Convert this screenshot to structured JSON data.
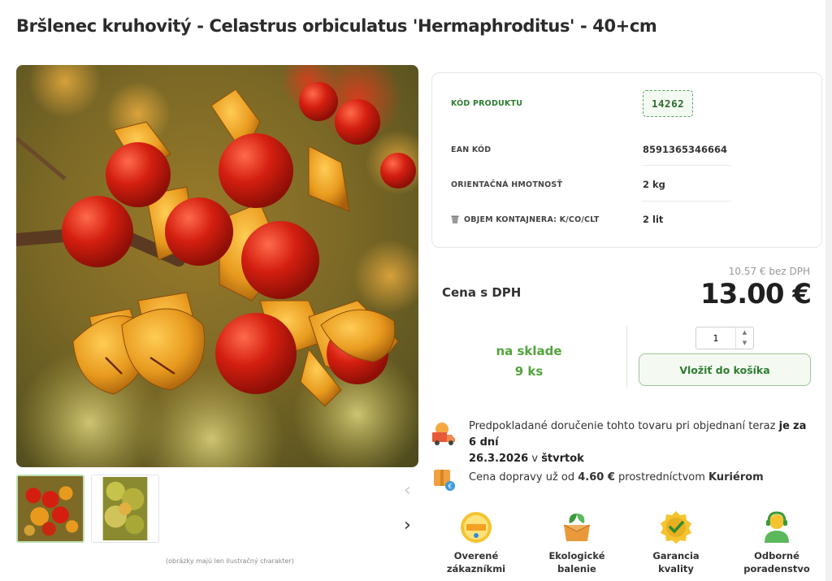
{
  "product": {
    "title": "Bršlenec kruhovitý - Celastrus orbiculatus 'Hermaphroditus' - 40+cm",
    "image_note": "(obrázky majú len ilustračný charakter)"
  },
  "info": {
    "code_label": "KÓD PRODUKTU",
    "code_value": "14262",
    "ean_label": "EAN KÓD",
    "ean_value": "8591365346664",
    "weight_label": "ORIENTAČNÁ HMOTNOSŤ",
    "weight_value": "2 kg",
    "container_label": "OBJEM KONTAJNERA: K/CO/CLT",
    "container_value": "2 lit"
  },
  "price": {
    "without_vat": "10.57 € bez DPH",
    "label": "Cena s DPH",
    "value": "13.00 €"
  },
  "stock": {
    "line1": "na sklade",
    "line2": "9 ks"
  },
  "cart": {
    "quantity": "1",
    "button_label": "Vložiť do košíka"
  },
  "delivery": {
    "text": "Predpokladané doručenie tohto tovaru pri objednaní teraz",
    "je": "je",
    "days": "za 6 dní",
    "date": "26.3.2026",
    "v": "v",
    "weekday": "štvrtok"
  },
  "shipping": {
    "prefix": "Cena dopravy už od",
    "price": "4.60 €",
    "middle": "prostredníctvom",
    "carrier": "Kuriérom"
  },
  "badges": [
    {
      "line1": "Overené",
      "line2": "zákazníkmi",
      "icon": "verified-seal-icon"
    },
    {
      "line1": "Ekologické",
      "line2": "balenie",
      "icon": "eco-box-icon"
    },
    {
      "line1": "Garancia",
      "line2": "kvality",
      "icon": "quality-check-icon"
    },
    {
      "line1": "Odborné",
      "line2": "poradenstvo",
      "icon": "advisor-icon"
    }
  ],
  "colors": {
    "accent_green": "#52a43c",
    "button_border": "#9fc596",
    "code_border": "#5aa65f"
  }
}
